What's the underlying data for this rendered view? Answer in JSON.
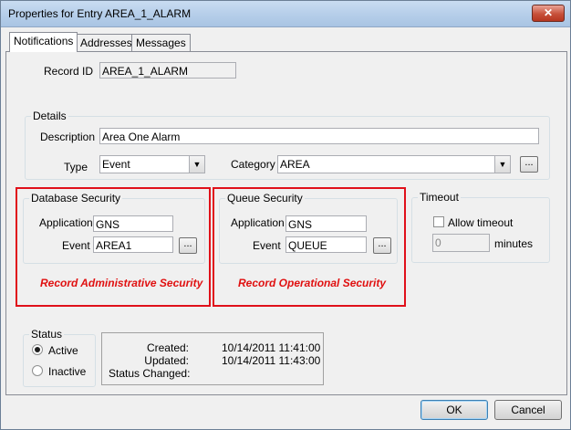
{
  "window": {
    "title": "Properties for Entry AREA_1_ALARM",
    "close_glyph": "✕"
  },
  "tabs": [
    {
      "label": "Notifications",
      "active": true
    },
    {
      "label": "Addresses",
      "active": false
    },
    {
      "label": "Messages",
      "active": false
    }
  ],
  "record": {
    "label": "Record ID",
    "value": "AREA_1_ALARM"
  },
  "details": {
    "title": "Details",
    "description_label": "Description",
    "description_value": "Area One Alarm",
    "type_label": "Type",
    "type_value": "Event",
    "category_label": "Category",
    "category_value": "AREA",
    "browse_label": "..."
  },
  "database_security": {
    "title": "Database Security",
    "application_label": "Application",
    "application_value": "GNS",
    "event_label": "Event",
    "event_value": "AREA1",
    "browse_label": "...",
    "annotation": "Record Administrative Security"
  },
  "queue_security": {
    "title": "Queue Security",
    "application_label": "Application",
    "application_value": "GNS",
    "event_label": "Event",
    "event_value": "QUEUE",
    "browse_label": "...",
    "annotation": "Record Operational Security"
  },
  "timeout": {
    "title": "Timeout",
    "allow_label": "Allow timeout",
    "allow_checked": false,
    "value": "0",
    "unit": "minutes"
  },
  "status": {
    "title": "Status",
    "options": [
      {
        "label": "Active",
        "selected": true
      },
      {
        "label": "Inactive",
        "selected": false
      }
    ],
    "created_label": "Created:",
    "created_value": "10/14/2011 11:41:00",
    "updated_label": "Updated:",
    "updated_value": "10/14/2011 11:43:00",
    "changed_label": "Status Changed:",
    "changed_value": ""
  },
  "buttons": {
    "ok": "OK",
    "cancel": "Cancel"
  },
  "colors": {
    "annotation_red": "#e01010",
    "titlebar": "#b7cfea"
  }
}
